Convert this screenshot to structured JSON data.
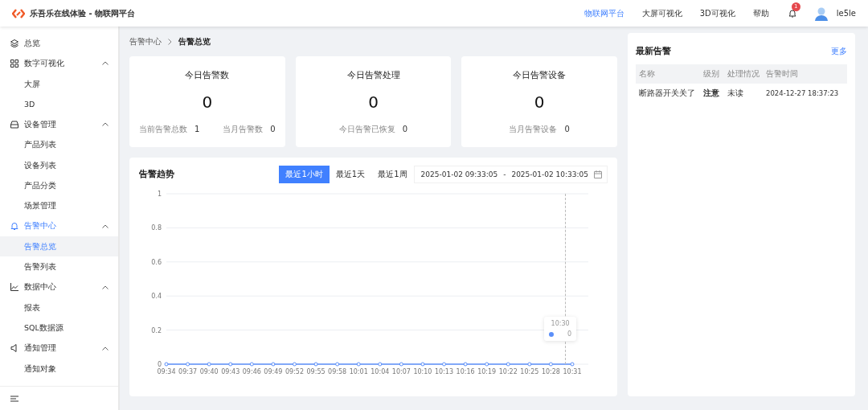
{
  "header": {
    "title": "乐吾乐在线体验 - 物联网平台",
    "nav": [
      {
        "label": "物联网平台",
        "selected": true
      },
      {
        "label": "大屏可视化",
        "selected": false
      },
      {
        "label": "3D可视化",
        "selected": false
      },
      {
        "label": "帮助",
        "selected": false
      }
    ],
    "notification_badge": "1",
    "username": "le5le"
  },
  "sidebar": {
    "items": [
      {
        "label": "总览",
        "selected": false
      },
      {
        "label": "数字可视化",
        "expanded": true,
        "selected": false,
        "children": [
          {
            "label": "大屏",
            "selected": false
          },
          {
            "label": "3D",
            "selected": false
          }
        ]
      },
      {
        "label": "设备管理",
        "expanded": true,
        "selected": false,
        "children": [
          {
            "label": "产品列表",
            "selected": false
          },
          {
            "label": "设备列表",
            "selected": false
          },
          {
            "label": "产品分类",
            "selected": false
          },
          {
            "label": "场景管理",
            "selected": false
          }
        ]
      },
      {
        "label": "告警中心",
        "expanded": true,
        "selected": true,
        "children": [
          {
            "label": "告警总览",
            "selected": true
          },
          {
            "label": "告警列表",
            "selected": false
          }
        ]
      },
      {
        "label": "数据中心",
        "expanded": true,
        "selected": false,
        "children": [
          {
            "label": "报表",
            "selected": false
          },
          {
            "label": "SQL数据源",
            "selected": false
          }
        ]
      },
      {
        "label": "通知管理",
        "expanded": true,
        "selected": false,
        "children": [
          {
            "label": "通知对象",
            "selected": false
          }
        ]
      }
    ]
  },
  "breadcrumb": [
    "告警中心",
    "告警总览"
  ],
  "stat_cards": [
    {
      "title": "今日告警数",
      "value": "0",
      "details": [
        {
          "label": "当前告警总数",
          "value": "1"
        },
        {
          "label": "当月告警数",
          "value": "0"
        }
      ]
    },
    {
      "title": "今日告警处理",
      "value": "0",
      "details": [
        {
          "label": "今日告警已恢复",
          "value": "0"
        }
      ]
    },
    {
      "title": "今日告警设备",
      "value": "0",
      "details": [
        {
          "label": "当月告警设备",
          "value": "0"
        }
      ]
    }
  ],
  "trend": {
    "title": "告警趋势",
    "ranges": [
      {
        "label": "最近1小时",
        "selected": true
      },
      {
        "label": "最近1天",
        "selected": false
      },
      {
        "label": "最近1周",
        "selected": false
      }
    ],
    "date_start": "2025-01-02 09:33:05",
    "date_separator": "-",
    "date_end": "2025-01-02 10:33:05",
    "chart_data": {
      "type": "line",
      "grid": true,
      "ylim": [
        0,
        1
      ],
      "yticks": [
        0,
        0.2,
        0.4,
        0.6,
        0.8,
        1
      ],
      "categories": [
        "09:34",
        "09:37",
        "09:40",
        "09:43",
        "09:46",
        "09:49",
        "09:52",
        "09:55",
        "09:58",
        "10:01",
        "10:04",
        "10:07",
        "10:10",
        "10:13",
        "10:16",
        "10:19",
        "10:22",
        "10:25",
        "10:28",
        "10:31"
      ],
      "series": [
        {
          "color": "#5b8ff9",
          "marker": "circle",
          "values": [
            0,
            0,
            0,
            0,
            0,
            0,
            0,
            0,
            0,
            0,
            0,
            0,
            0,
            0,
            0,
            0,
            0,
            0,
            0,
            0
          ]
        }
      ]
    },
    "tooltip": {
      "label": "10:30",
      "value": "0"
    }
  },
  "latest": {
    "title": "最新告警",
    "more": "更多",
    "columns": [
      "名称",
      "级别",
      "处理情况",
      "告警时间"
    ],
    "rows": [
      [
        "断路器开关关了",
        "注意",
        "未读",
        "2024-12-27 18:37:23"
      ]
    ]
  }
}
